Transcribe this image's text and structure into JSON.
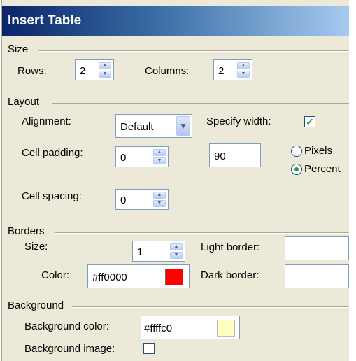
{
  "title": "Insert Table",
  "size": {
    "heading": "Size",
    "rows_label": "Rows:",
    "rows_value": "2",
    "columns_label": "Columns:",
    "columns_value": "2"
  },
  "layout": {
    "heading": "Layout",
    "alignment_label": "Alignment:",
    "alignment_value": "Default",
    "specify_width_label": "Specify width:",
    "specify_width_checked": true,
    "cell_padding_label": "Cell padding:",
    "cell_padding_value": "0",
    "width_value": "90",
    "pixels_label": "Pixels",
    "percent_label": "Percent",
    "selected_unit": "Percent",
    "cell_spacing_label": "Cell spacing:",
    "cell_spacing_value": "0"
  },
  "borders": {
    "heading": "Borders",
    "size_label": "Size:",
    "size_value": "1",
    "color_label": "Color:",
    "color_value": "#ff0000",
    "light_border_label": "Light border:",
    "light_border_value": "",
    "dark_border_label": "Dark border:",
    "dark_border_value": ""
  },
  "background": {
    "heading": "Background",
    "color_label": "Background color:",
    "color_value": "#ffffc0",
    "image_label": "Background image:",
    "image_checked": false
  },
  "colors": {
    "border_color_swatch": "#ff0000",
    "background_color_swatch": "#ffffc0"
  }
}
